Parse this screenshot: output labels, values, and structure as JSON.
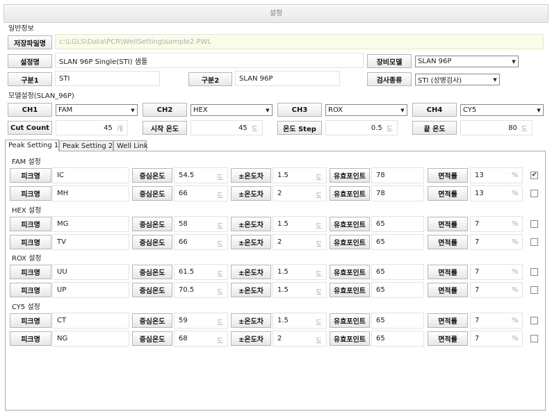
{
  "window": {
    "title": "설정"
  },
  "general": {
    "section": "일반정보",
    "save_file_label": "저장파일명",
    "save_file_value": "c:\\LGLS\\Data\\PCR\\WellSetting\\sample2.PWL",
    "setting_name_label": "설정명",
    "setting_name_value": "SLAN 96P Single(STI) 샘플",
    "device_model_label": "장비모델",
    "device_model_value": "SLAN 96P",
    "category1_label": "구분1",
    "category1_value": "STI",
    "category2_label": "구분2",
    "category2_value": "SLAN 96P",
    "test_type_label": "검사종류",
    "test_type_value": "STI (성병검사)"
  },
  "model": {
    "section": "모델설정(SLAN_96P)",
    "ch1_label": "CH1",
    "ch1_value": "FAM",
    "ch2_label": "CH2",
    "ch2_value": "HEX",
    "ch3_label": "CH3",
    "ch3_value": "ROX",
    "ch4_label": "CH4",
    "ch4_value": "CY5",
    "cut_count_label": "Cut Count",
    "cut_count_value": "45",
    "cut_count_unit": "개",
    "start_temp_label": "시작 온도",
    "start_temp_value": "45",
    "start_temp_unit": "도",
    "temp_step_label": "온도 Step",
    "temp_step_value": "0.5",
    "temp_step_unit": "도",
    "end_temp_label": "끝 온도",
    "end_temp_value": "80",
    "end_temp_unit": "도"
  },
  "tabs": [
    "Peak Setting 1",
    "Peak Setting 2",
    "Well Link"
  ],
  "peak_labels": {
    "peak_name": "피크명",
    "center_temp": "중심온도",
    "temp_diff": "±온도차",
    "valid_points": "유효포인트",
    "area_ratio": "면적률",
    "deg_unit": "도",
    "pct_unit": "%"
  },
  "groups": [
    {
      "title": "FAM 설정",
      "rows": [
        {
          "name": "IC",
          "center": "54.5",
          "diff": "1.5",
          "points": "78",
          "area": "13",
          "checked": true
        },
        {
          "name": "MH",
          "center": "66",
          "diff": "2",
          "points": "78",
          "area": "13",
          "checked": false
        }
      ]
    },
    {
      "title": "HEX 설정",
      "rows": [
        {
          "name": "MG",
          "center": "58",
          "diff": "1.5",
          "points": "65",
          "area": "7",
          "checked": false
        },
        {
          "name": "TV",
          "center": "66",
          "diff": "2",
          "points": "65",
          "area": "7",
          "checked": false
        }
      ]
    },
    {
      "title": "ROX 설정",
      "rows": [
        {
          "name": "UU",
          "center": "61.5",
          "diff": "1.5",
          "points": "65",
          "area": "7",
          "checked": false
        },
        {
          "name": "UP",
          "center": "70.5",
          "diff": "1.5",
          "points": "65",
          "area": "7",
          "checked": false
        }
      ]
    },
    {
      "title": "CY5 설정",
      "rows": [
        {
          "name": "CT",
          "center": "59",
          "diff": "1.5",
          "points": "65",
          "area": "7",
          "checked": false
        },
        {
          "name": "NG",
          "center": "68",
          "diff": "2",
          "points": "65",
          "area": "7",
          "checked": false
        }
      ]
    }
  ]
}
